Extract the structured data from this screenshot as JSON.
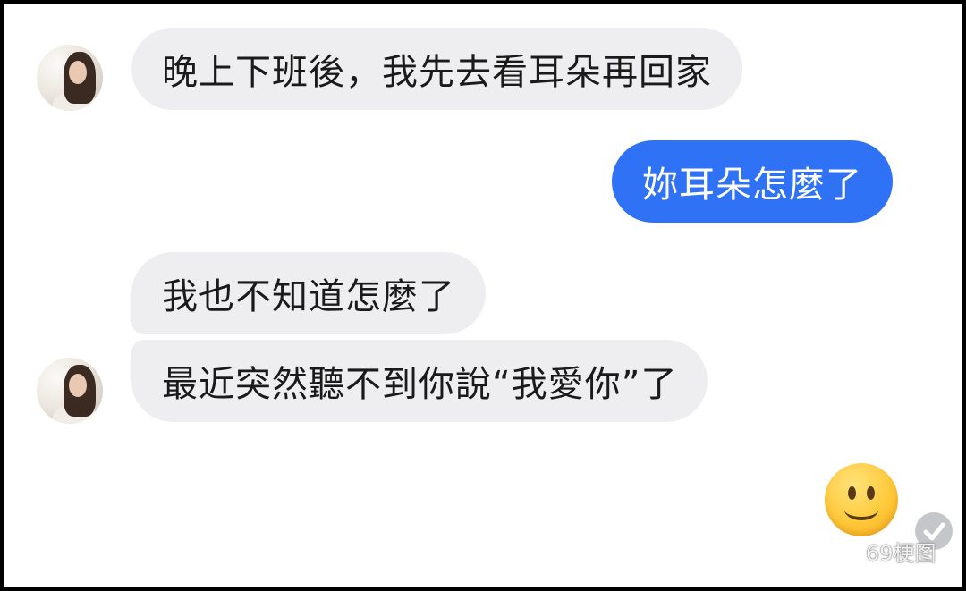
{
  "conversation": {
    "messages": [
      {
        "sender": "contact",
        "text": "晚上下班後，我先去看耳朵再回家"
      },
      {
        "sender": "me",
        "text": "妳耳朵怎麼了"
      },
      {
        "sender": "contact",
        "text": "我也不知道怎麼了"
      },
      {
        "sender": "contact",
        "text": "最近突然聽不到你說“我愛你”了"
      },
      {
        "sender": "me",
        "type": "emoji",
        "icon": "slightly-smiling-face"
      }
    ]
  },
  "status": {
    "read_icon": "checkmark-circle-icon"
  },
  "watermark": {
    "text": "69梗图",
    "icon": "wechat-icon"
  },
  "colors": {
    "incoming_bubble": "#eeeef0",
    "outgoing_bubble": "#2f72f6",
    "outgoing_text": "#ffffff"
  }
}
